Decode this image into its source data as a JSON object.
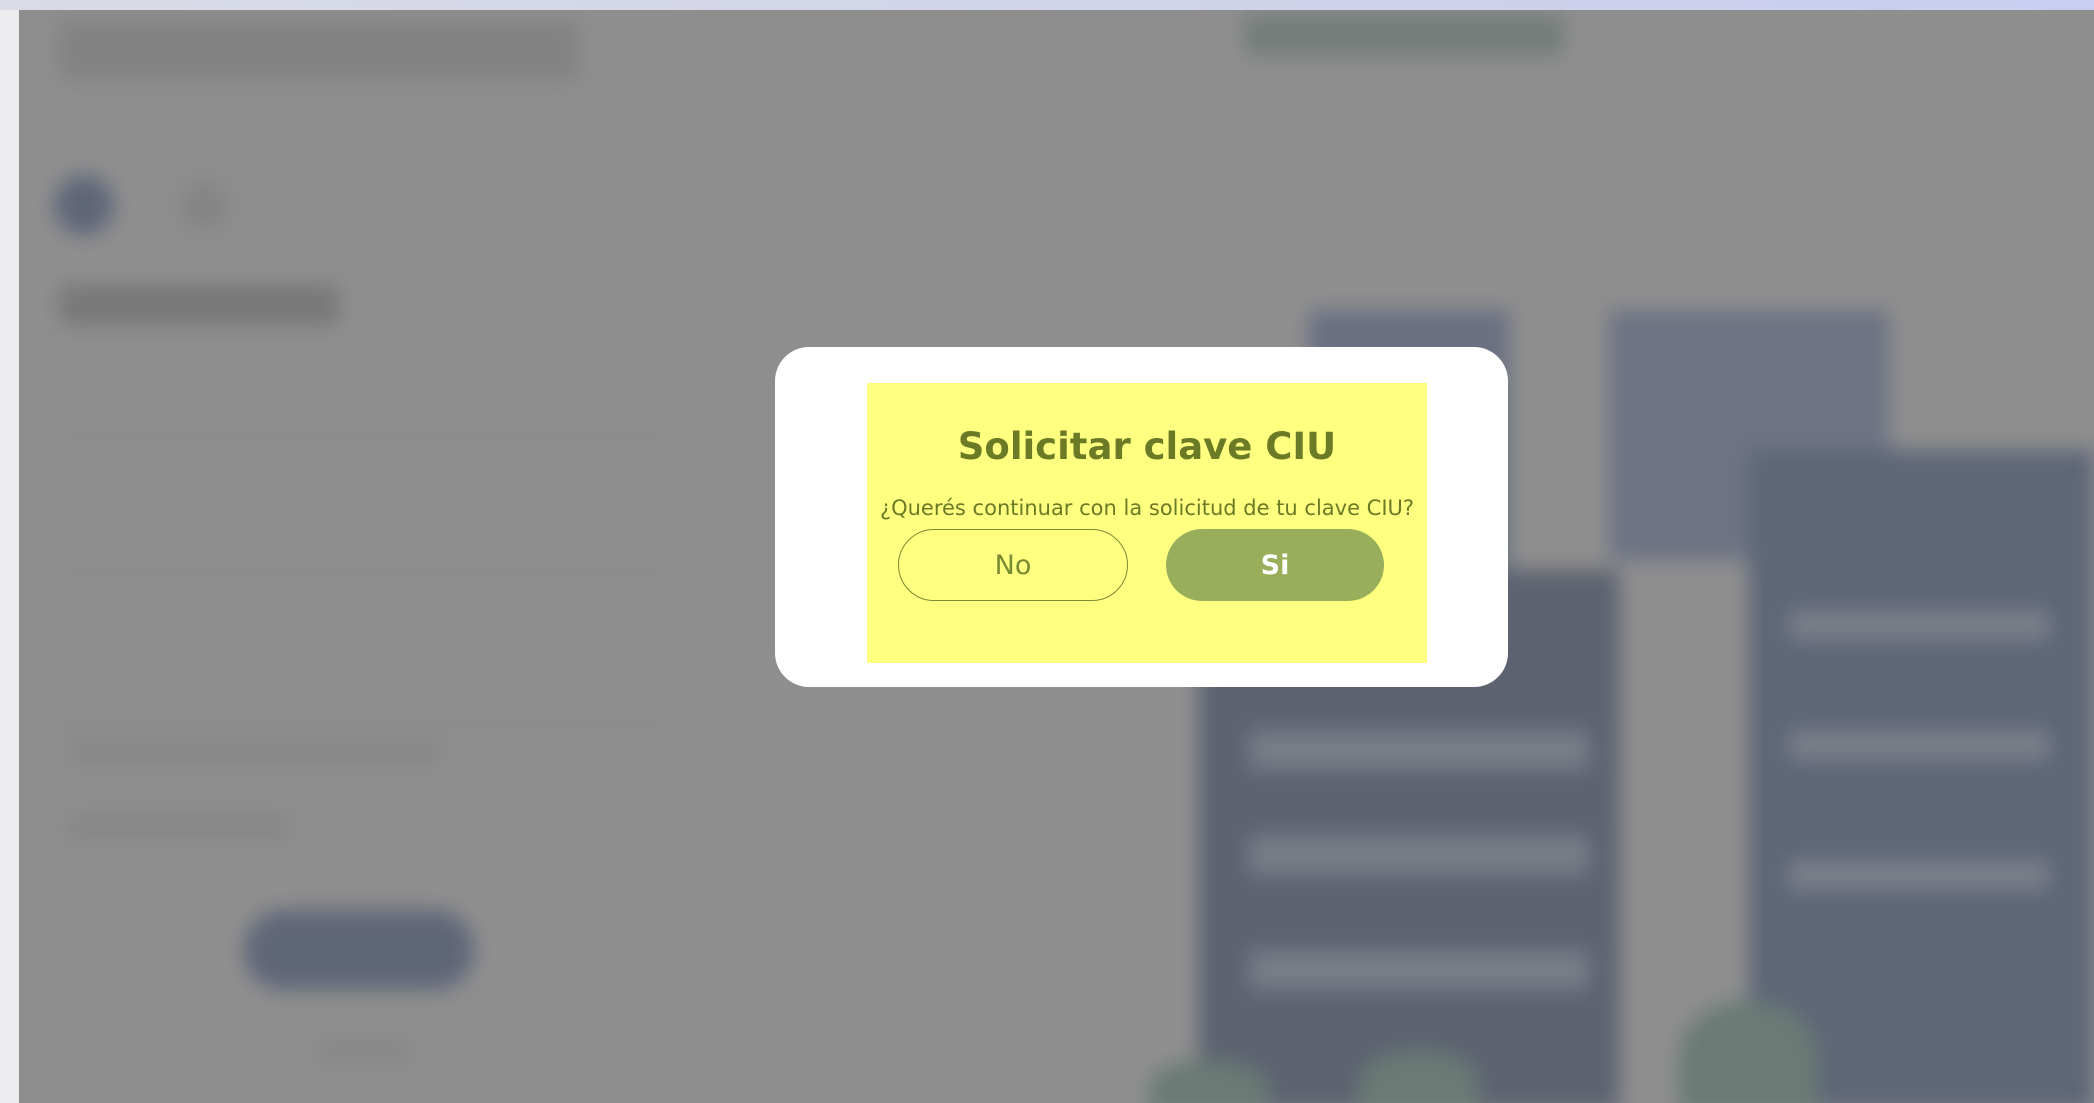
{
  "dialog": {
    "title": "Solicitar clave CIU",
    "question": "¿Querés continuar con la solicitud de tu clave CIU?",
    "no_label": "No",
    "yes_label": "Si"
  },
  "colors": {
    "dialog_highlight": "#ffff80",
    "title_text": "#6b7a25",
    "yes_button": "#98ae5a",
    "overlay": "#6e6e6e",
    "building_blue": "#1f3a75"
  }
}
